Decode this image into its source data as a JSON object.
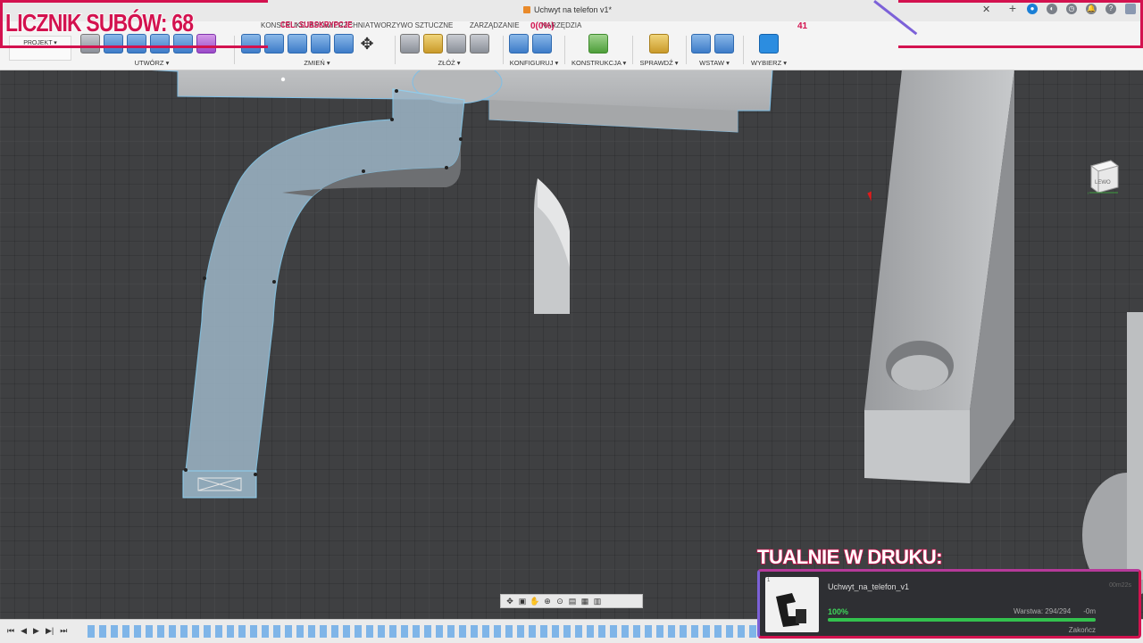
{
  "window": {
    "title": "Uchwyt na telefon v1*"
  },
  "tabs": [
    "KONSTRUKCJA",
    "POWIERZCHNIA",
    "TWORZYWO SZTUCZNE",
    "ZARZĄDZANIE",
    "NARZĘDZIA"
  ],
  "project_button": "PROJEKT",
  "toolbar_groups": [
    {
      "label": "UTWÓRZ ▾",
      "icon": "create-tools-icon"
    },
    {
      "label": "ZMIEŃ ▾",
      "icon": "modify-tools-icon"
    },
    {
      "label": "ZŁÓŻ ▾",
      "icon": "assemble-tools-icon"
    },
    {
      "label": "KONFIGURUJ ▾",
      "icon": "configure-tools-icon"
    },
    {
      "label": "KONSTRUKCJA ▾",
      "icon": "construct-tools-icon"
    },
    {
      "label": "SPRAWDŹ ▾",
      "icon": "inspect-tools-icon"
    },
    {
      "label": "WSTAW ▾",
      "icon": "insert-tools-icon"
    },
    {
      "label": "WYBIERZ ▾",
      "icon": "select-tools-icon"
    }
  ],
  "stream_overlay": {
    "sub_counter": "LICZNIK SUBÓW: 68",
    "sub_goal": "CEL: SUBSKRYPCJE",
    "sub_percent": "0(0%)",
    "sub_count_right": "41",
    "printing_label": "TUALNIE W DRUKU:"
  },
  "print_job": {
    "index": "1",
    "name": "Uchwyt_na_telefon_v1",
    "time": "00m22s",
    "percent": "100%",
    "progress": 1.0,
    "layer": "Warstwa: 294/294",
    "remaining": "-0m",
    "finish": "Zakończ"
  },
  "viewcube": {
    "label": "LEWO"
  },
  "colors": {
    "accent": "#d3124f",
    "overlay_secondary": "#7c61d8",
    "selection": "#6fb6e0",
    "progress": "#33c24e"
  }
}
